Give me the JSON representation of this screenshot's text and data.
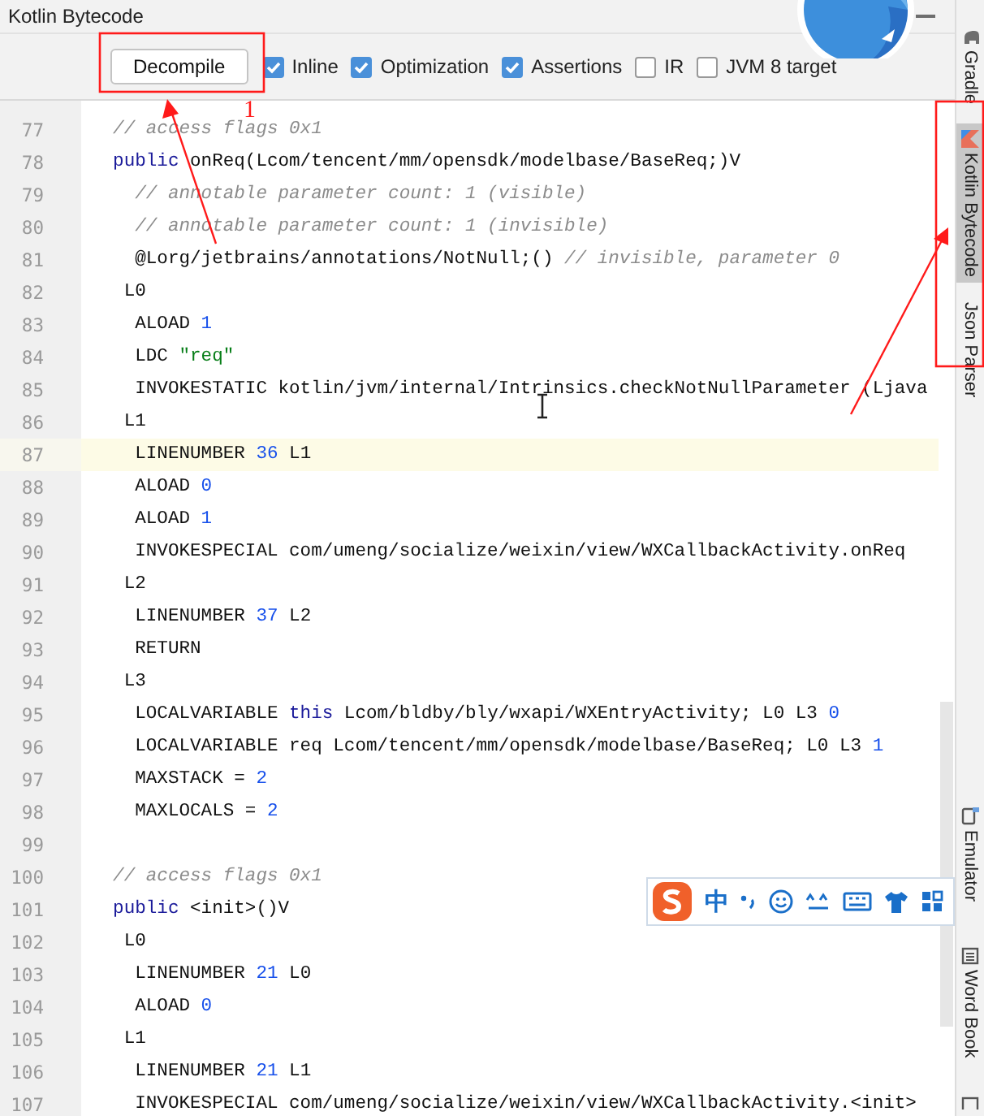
{
  "window": {
    "title": "Kotlin Bytecode"
  },
  "toolbar": {
    "button": "Decompile",
    "options": [
      {
        "label": "Inline",
        "checked": true
      },
      {
        "label": "Optimization",
        "checked": true
      },
      {
        "label": "Assertions",
        "checked": true
      },
      {
        "label": "IR",
        "checked": false
      },
      {
        "label": "JVM 8 target",
        "checked": false
      }
    ]
  },
  "editor": {
    "lines": [
      {
        "number": "77",
        "current": false,
        "tokens": [
          {
            "kind": "comment",
            "text": "  // access flags 0x1"
          }
        ]
      },
      {
        "number": "78",
        "current": false,
        "tokens": [
          {
            "kind": "keyword",
            "text": "  public"
          },
          {
            "kind": "plain",
            "text": " onReq(Lcom/tencent/mm/opensdk/modelbase/BaseReq;)V"
          }
        ]
      },
      {
        "number": "79",
        "current": false,
        "tokens": [
          {
            "kind": "comment",
            "text": "    // annotable parameter count: 1 (visible)"
          }
        ]
      },
      {
        "number": "80",
        "current": false,
        "tokens": [
          {
            "kind": "comment",
            "text": "    // annotable parameter count: 1 (invisible)"
          }
        ]
      },
      {
        "number": "81",
        "current": false,
        "tokens": [
          {
            "kind": "plain",
            "text": "    @Lorg/jetbrains/annotations/NotNull;() "
          },
          {
            "kind": "comment",
            "text": "// invisible, parameter 0"
          }
        ]
      },
      {
        "number": "82",
        "current": false,
        "tokens": [
          {
            "kind": "plain",
            "text": "   L0"
          }
        ]
      },
      {
        "number": "83",
        "current": false,
        "tokens": [
          {
            "kind": "plain",
            "text": "    ALOAD "
          },
          {
            "kind": "number",
            "text": "1"
          }
        ]
      },
      {
        "number": "84",
        "current": false,
        "tokens": [
          {
            "kind": "plain",
            "text": "    LDC "
          },
          {
            "kind": "string",
            "text": "\"req\""
          }
        ]
      },
      {
        "number": "85",
        "current": false,
        "tokens": [
          {
            "kind": "plain",
            "text": "    INVOKESTATIC kotlin/jvm/internal/Intrinsics.checkNotNullParameter (Ljava"
          }
        ]
      },
      {
        "number": "86",
        "current": false,
        "tokens": [
          {
            "kind": "plain",
            "text": "   L1"
          }
        ]
      },
      {
        "number": "87",
        "current": true,
        "tokens": [
          {
            "kind": "plain",
            "text": "    LINENUMBER "
          },
          {
            "kind": "number",
            "text": "36"
          },
          {
            "kind": "plain",
            "text": " L1"
          }
        ]
      },
      {
        "number": "88",
        "current": false,
        "tokens": [
          {
            "kind": "plain",
            "text": "    ALOAD "
          },
          {
            "kind": "number",
            "text": "0"
          }
        ]
      },
      {
        "number": "89",
        "current": false,
        "tokens": [
          {
            "kind": "plain",
            "text": "    ALOAD "
          },
          {
            "kind": "number",
            "text": "1"
          }
        ]
      },
      {
        "number": "90",
        "current": false,
        "tokens": [
          {
            "kind": "plain",
            "text": "    INVOKESPECIAL com/umeng/socialize/weixin/view/WXCallbackActivity.onReq"
          }
        ]
      },
      {
        "number": "91",
        "current": false,
        "tokens": [
          {
            "kind": "plain",
            "text": "   L2"
          }
        ]
      },
      {
        "number": "92",
        "current": false,
        "tokens": [
          {
            "kind": "plain",
            "text": "    LINENUMBER "
          },
          {
            "kind": "number",
            "text": "37"
          },
          {
            "kind": "plain",
            "text": " L2"
          }
        ]
      },
      {
        "number": "93",
        "current": false,
        "tokens": [
          {
            "kind": "plain",
            "text": "    RETURN"
          }
        ]
      },
      {
        "number": "94",
        "current": false,
        "tokens": [
          {
            "kind": "plain",
            "text": "   L3"
          }
        ]
      },
      {
        "number": "95",
        "current": false,
        "tokens": [
          {
            "kind": "plain",
            "text": "    LOCALVARIABLE "
          },
          {
            "kind": "keyword",
            "text": "this"
          },
          {
            "kind": "plain",
            "text": " Lcom/bldby/bly/wxapi/WXEntryActivity; L0 L3 "
          },
          {
            "kind": "number",
            "text": "0"
          }
        ]
      },
      {
        "number": "96",
        "current": false,
        "tokens": [
          {
            "kind": "plain",
            "text": "    LOCALVARIABLE req Lcom/tencent/mm/opensdk/modelbase/BaseReq; L0 L3 "
          },
          {
            "kind": "number",
            "text": "1"
          }
        ]
      },
      {
        "number": "97",
        "current": false,
        "tokens": [
          {
            "kind": "plain",
            "text": "    MAXSTACK = "
          },
          {
            "kind": "number",
            "text": "2"
          }
        ]
      },
      {
        "number": "98",
        "current": false,
        "tokens": [
          {
            "kind": "plain",
            "text": "    MAXLOCALS = "
          },
          {
            "kind": "number",
            "text": "2"
          }
        ]
      },
      {
        "number": "99",
        "current": false
      },
      {
        "number": "100",
        "current": false,
        "tokens": [
          {
            "kind": "comment",
            "text": "  // access flags 0x1"
          }
        ]
      },
      {
        "number": "101",
        "current": false,
        "tokens": [
          {
            "kind": "keyword",
            "text": "  public"
          },
          {
            "kind": "plain",
            "text": " <init>()V"
          }
        ]
      },
      {
        "number": "102",
        "current": false,
        "tokens": [
          {
            "kind": "plain",
            "text": "   L0"
          }
        ]
      },
      {
        "number": "103",
        "current": false,
        "tokens": [
          {
            "kind": "plain",
            "text": "    LINENUMBER "
          },
          {
            "kind": "number",
            "text": "21"
          },
          {
            "kind": "plain",
            "text": " L0"
          }
        ]
      },
      {
        "number": "104",
        "current": false,
        "tokens": [
          {
            "kind": "plain",
            "text": "    ALOAD "
          },
          {
            "kind": "number",
            "text": "0"
          }
        ]
      },
      {
        "number": "105",
        "current": false,
        "tokens": [
          {
            "kind": "plain",
            "text": "   L1"
          }
        ]
      },
      {
        "number": "106",
        "current": false,
        "tokens": [
          {
            "kind": "plain",
            "text": "    LINENUMBER "
          },
          {
            "kind": "number",
            "text": "21"
          },
          {
            "kind": "plain",
            "text": " L1"
          }
        ]
      },
      {
        "number": "107",
        "current": false,
        "tokens": [
          {
            "kind": "plain",
            "text": "    INVOKESPECIAL com/umeng/socialize/weixin/view/WXCallbackActivity.<init>"
          }
        ]
      }
    ]
  },
  "tool_strip": {
    "top": [
      {
        "label": "Gradle",
        "selected": false
      },
      {
        "label": "Kotlin Bytecode",
        "selected": true
      },
      {
        "label": "Json Parser",
        "selected": false
      }
    ],
    "bottom": [
      {
        "label": "Emulator",
        "selected": false
      },
      {
        "label": "Word Book",
        "selected": false
      }
    ]
  },
  "ime_toolbar": {
    "mode": "中"
  },
  "annotation": {
    "marker": "1"
  }
}
